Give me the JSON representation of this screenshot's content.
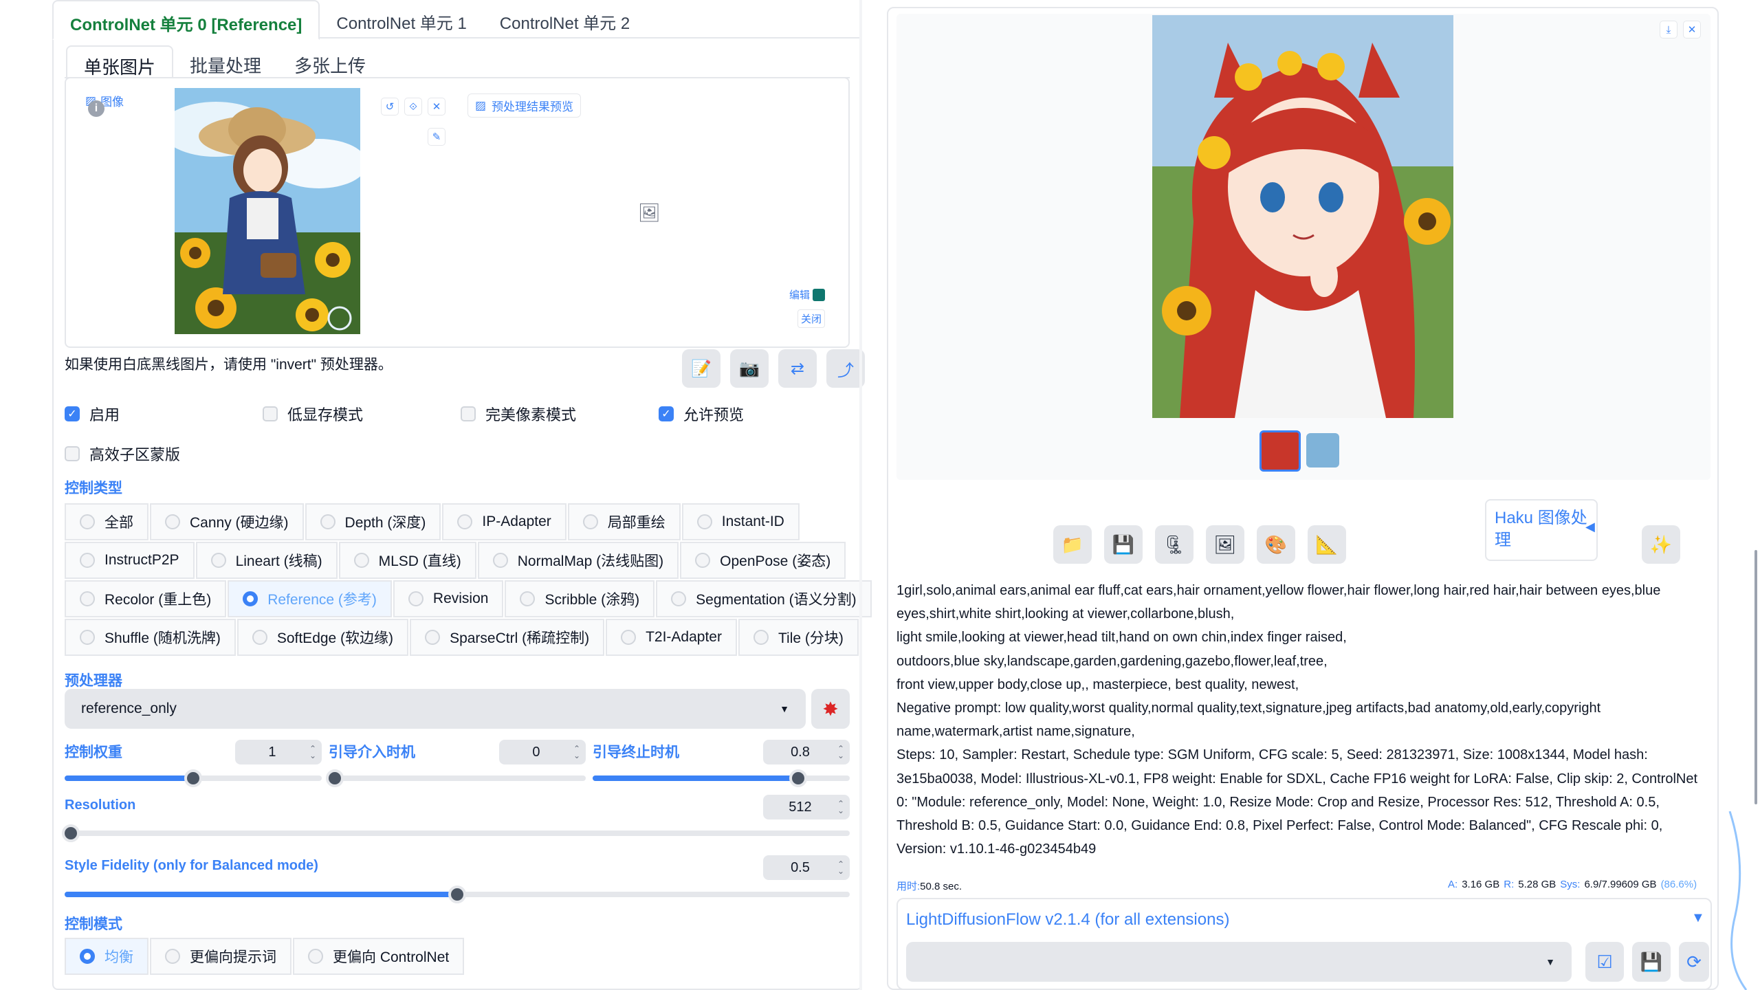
{
  "controlnet_tabs": [
    "ControlNet 单元 0 [Reference]",
    "ControlNet 单元 1",
    "ControlNet 单元 2"
  ],
  "input_tabs": [
    "单张图片",
    "批量处理",
    "多张上传"
  ],
  "image_label": "图像",
  "preprocess_preview_label": "预处理结果预览",
  "edit_label": "编辑",
  "close_label": "关闭",
  "invert_hint": "如果使用白底黑线图片，请使用 \"invert\" 预处理器。",
  "checkboxes": [
    {
      "label": "启用",
      "checked": true
    },
    {
      "label": "低显存模式",
      "checked": false
    },
    {
      "label": "完美像素模式",
      "checked": false
    },
    {
      "label": "允许预览",
      "checked": true
    },
    {
      "label": "高效子区蒙版",
      "checked": false
    }
  ],
  "control_type_label": "控制类型",
  "control_types": [
    [
      "全部",
      "Canny (硬边缘)",
      "Depth (深度)",
      "IP-Adapter",
      "局部重绘",
      "Instant-ID"
    ],
    [
      "InstructP2P",
      "Lineart (线稿)",
      "MLSD (直线)",
      "NormalMap (法线贴图)",
      "OpenPose (姿态)"
    ],
    [
      "Recolor (重上色)",
      "Reference (参考)",
      "Revision",
      "Scribble (涂鸦)",
      "Segmentation (语义分割)"
    ],
    [
      "Shuffle (随机洗牌)",
      "SoftEdge (软边缘)",
      "SparseCtrl (稀疏控制)",
      "T2I-Adapter",
      "Tile (分块)"
    ]
  ],
  "selected_control_type": "Reference (参考)",
  "preprocessor_label": "预处理器",
  "preprocessor_value": "reference_only",
  "control_weight": {
    "label": "控制权重",
    "value": "1",
    "fraction": 0.5
  },
  "guidance_start": {
    "label": "引导介入时机",
    "value": "0",
    "fraction": 0.0
  },
  "guidance_end": {
    "label": "引导终止时机",
    "value": "0.8",
    "fraction": 0.8
  },
  "resolution": {
    "label": "Resolution",
    "value": "512",
    "fraction": 0.0
  },
  "style_fidelity": {
    "label": "Style Fidelity (only for Balanced mode)",
    "value": "0.5",
    "fraction": 0.5
  },
  "control_mode_label": "控制模式",
  "control_modes": [
    "均衡",
    "更偏向提示词",
    "更偏向 ControlNet"
  ],
  "selected_control_mode": "均衡",
  "haku_label": "Haku 图像处理",
  "info_lines": [
    "1girl,solo,animal ears,animal ear fluff,cat ears,hair ornament,yellow flower,hair flower,long hair,red hair,hair between eyes,blue eyes,shirt,white shirt,looking at viewer,collarbone,blush,",
    "light smile,looking at viewer,head tilt,hand on own chin,index finger raised,",
    "outdoors,blue sky,landscape,garden,gardening,gazebo,flower,leaf,tree,",
    "front view,upper body,close up,, masterpiece, best quality, newest,",
    "Negative prompt: low quality,worst quality,normal quality,text,signature,jpeg artifacts,bad anatomy,old,early,copyright name,watermark,artist name,signature,",
    "Steps: 10, Sampler: Restart, Schedule type: SGM Uniform, CFG scale: 5, Seed: 281323971, Size: 1008x1344, Model hash: 3e15ba0038, Model: Illustrious-XL-v0.1, FP8 weight: Enable for SDXL, Cache FP16 weight for LoRA: False, Clip skip: 2, ControlNet 0: \"Module: reference_only, Model: None, Weight: 1.0, Resize Mode: Crop and Resize, Processor Res: 512, Threshold A: 0.5, Threshold B: 0.5, Guidance Start: 0.0, Guidance End: 0.8, Pixel Perfect: False, Control Mode: Balanced\", CFG Rescale phi: 0, Version: v1.10.1-46-g023454b49"
  ],
  "time_label": "用时:",
  "time_value": "50.8 sec.",
  "mem": {
    "a_label": "A:",
    "a_value": "3.16 GB",
    "r_label": "R:",
    "r_value": "5.28 GB",
    "sys_label": "Sys:",
    "sys_value": "6.9/7.99609 GB",
    "pct": "(86.6%)"
  },
  "ldf_title": "LightDiffusionFlow v2.1.4 (for all extensions)",
  "colors": {
    "accent": "#3b82f6",
    "active_tab": "#15803d"
  }
}
